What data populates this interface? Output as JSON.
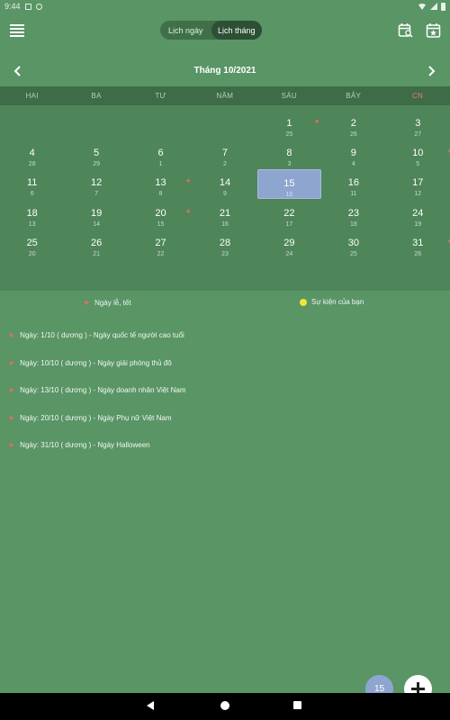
{
  "status_bar": {
    "time": "9:44"
  },
  "header": {
    "tabs": [
      "Lịch ngày",
      "Lịch tháng"
    ],
    "active_tab": 1
  },
  "calendar": {
    "month_title": "Tháng 10/2021",
    "weekdays": [
      "HAI",
      "BA",
      "TƯ",
      "NĂM",
      "SÁU",
      "BẢY",
      "CN"
    ],
    "weeks": [
      [
        null,
        null,
        null,
        null,
        {
          "day": "1",
          "lunar": "25",
          "holiday": true
        },
        {
          "day": "2",
          "lunar": "26"
        },
        {
          "day": "3",
          "lunar": "27"
        }
      ],
      [
        {
          "day": "4",
          "lunar": "28"
        },
        {
          "day": "5",
          "lunar": "29"
        },
        {
          "day": "6",
          "lunar": "1"
        },
        {
          "day": "7",
          "lunar": "2"
        },
        {
          "day": "8",
          "lunar": "3"
        },
        {
          "day": "9",
          "lunar": "4"
        },
        {
          "day": "10",
          "lunar": "5",
          "holiday": true
        }
      ],
      [
        {
          "day": "11",
          "lunar": "6"
        },
        {
          "day": "12",
          "lunar": "7"
        },
        {
          "day": "13",
          "lunar": "8",
          "holiday": true
        },
        {
          "day": "14",
          "lunar": "9"
        },
        {
          "day": "15",
          "lunar": "10",
          "today": true
        },
        {
          "day": "16",
          "lunar": "11"
        },
        {
          "day": "17",
          "lunar": "12"
        }
      ],
      [
        {
          "day": "18",
          "lunar": "13"
        },
        {
          "day": "19",
          "lunar": "14"
        },
        {
          "day": "20",
          "lunar": "15",
          "holiday": true
        },
        {
          "day": "21",
          "lunar": "16"
        },
        {
          "day": "22",
          "lunar": "17"
        },
        {
          "day": "23",
          "lunar": "18"
        },
        {
          "day": "24",
          "lunar": "19"
        }
      ],
      [
        {
          "day": "25",
          "lunar": "20"
        },
        {
          "day": "26",
          "lunar": "21"
        },
        {
          "day": "27",
          "lunar": "22"
        },
        {
          "day": "28",
          "lunar": "23"
        },
        {
          "day": "29",
          "lunar": "24"
        },
        {
          "day": "30",
          "lunar": "25"
        },
        {
          "day": "31",
          "lunar": "26",
          "holiday": true
        }
      ]
    ]
  },
  "legend": {
    "holiday_label": "Ngày lễ, tết",
    "event_label": "Sự kiện của bạn"
  },
  "holidays": [
    "Ngày: 1/10 ( dương ) - Ngày quốc tế người cao tuổi",
    "Ngày: 10/10 ( dương ) - Ngày giải phóng thủ đô",
    "Ngày: 13/10 ( dương ) - Ngày doanh nhân Việt Nam",
    "Ngày: 20/10 ( dương ) - Ngày Phụ nữ Việt Nam",
    "Ngày: 31/10 ( dương ) - Ngày Halloween"
  ],
  "fab": {
    "today_label": "15"
  },
  "colors": {
    "background": "#599565",
    "weekday_bar": "#3e6c47",
    "grid": "#4e8559",
    "today": "#8ea5d0",
    "holiday_star": "#e07065",
    "event_dot": "#f1e53a",
    "sunday_header": "#e87a6c"
  }
}
